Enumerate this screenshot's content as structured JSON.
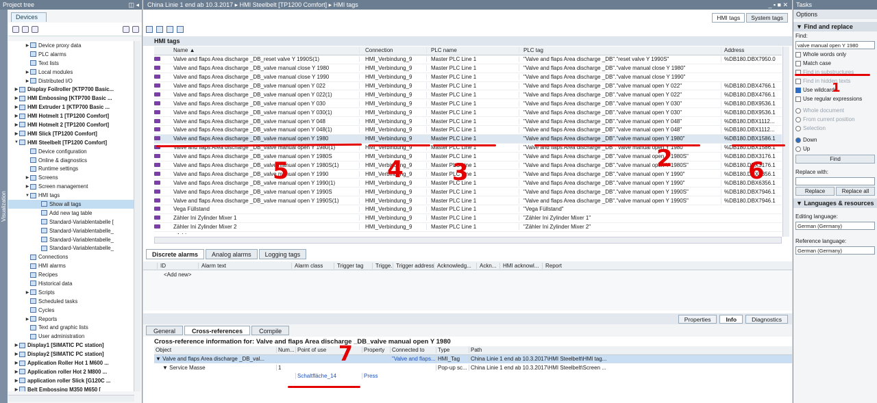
{
  "project_tree": {
    "title": "Project tree",
    "devices_tab": "Devices",
    "side_label": "Visualization",
    "items": [
      {
        "label": "Device proxy data",
        "bold": false,
        "arrow": "▶",
        "indent": 3
      },
      {
        "label": "PLC alarms",
        "bold": false,
        "arrow": "",
        "indent": 3
      },
      {
        "label": "Text lists",
        "bold": false,
        "arrow": "",
        "indent": 3
      },
      {
        "label": "Local modules",
        "bold": false,
        "arrow": "▶",
        "indent": 3
      },
      {
        "label": "Distributed I/O",
        "bold": false,
        "arrow": "▶",
        "indent": 3
      },
      {
        "label": "Display Foilroller [KTP700 Basic...",
        "bold": true,
        "arrow": "▶",
        "indent": 1
      },
      {
        "label": "HMI Embossing [KTP700 Basic ...",
        "bold": true,
        "arrow": "▶",
        "indent": 1
      },
      {
        "label": "HMI Extruder 1 [KTP700 Basic ...",
        "bold": true,
        "arrow": "▶",
        "indent": 1
      },
      {
        "label": "HMI Hotmelt 1 [TP1200 Comfort]",
        "bold": true,
        "arrow": "▶",
        "indent": 1
      },
      {
        "label": "HMI Hotmelt 2 [TP1200 Comfort]",
        "bold": true,
        "arrow": "▶",
        "indent": 1
      },
      {
        "label": "HMI Slick [TP1200 Comfort]",
        "bold": true,
        "arrow": "▶",
        "indent": 1
      },
      {
        "label": "HMI Steelbelt [TP1200 Comfort]",
        "bold": true,
        "arrow": "▼",
        "indent": 1
      },
      {
        "label": "Device configuration",
        "bold": false,
        "arrow": "",
        "indent": 3
      },
      {
        "label": "Online & diagnostics",
        "bold": false,
        "arrow": "",
        "indent": 3
      },
      {
        "label": "Runtime settings",
        "bold": false,
        "arrow": "",
        "indent": 3
      },
      {
        "label": "Screens",
        "bold": false,
        "arrow": "▶",
        "indent": 3
      },
      {
        "label": "Screen management",
        "bold": false,
        "arrow": "▶",
        "indent": 3
      },
      {
        "label": "HMI tags",
        "bold": false,
        "arrow": "▼",
        "indent": 3
      },
      {
        "label": "Show all tags",
        "bold": false,
        "arrow": "",
        "indent": 5,
        "selected": true
      },
      {
        "label": "Add new tag table",
        "bold": false,
        "arrow": "",
        "indent": 5
      },
      {
        "label": "Standard-Variablentabelle [",
        "bold": false,
        "arrow": "",
        "indent": 5
      },
      {
        "label": "Standard-Variablentabelle_",
        "bold": false,
        "arrow": "",
        "indent": 5
      },
      {
        "label": "Standard-Variablentabelle_",
        "bold": false,
        "arrow": "",
        "indent": 5
      },
      {
        "label": "Standard-Variablentabelle_",
        "bold": false,
        "arrow": "",
        "indent": 5
      },
      {
        "label": "Connections",
        "bold": false,
        "arrow": "",
        "indent": 3
      },
      {
        "label": "HMI alarms",
        "bold": false,
        "arrow": "",
        "indent": 3
      },
      {
        "label": "Recipes",
        "bold": false,
        "arrow": "",
        "indent": 3
      },
      {
        "label": "Historical data",
        "bold": false,
        "arrow": "",
        "indent": 3
      },
      {
        "label": "Scripts",
        "bold": false,
        "arrow": "▶",
        "indent": 3
      },
      {
        "label": "Scheduled tasks",
        "bold": false,
        "arrow": "",
        "indent": 3
      },
      {
        "label": "Cycles",
        "bold": false,
        "arrow": "",
        "indent": 3
      },
      {
        "label": "Reports",
        "bold": false,
        "arrow": "▶",
        "indent": 3
      },
      {
        "label": "Text and graphic lists",
        "bold": false,
        "arrow": "",
        "indent": 3
      },
      {
        "label": "User administration",
        "bold": false,
        "arrow": "",
        "indent": 3
      },
      {
        "label": "Display1 [SIMATIC PC station]",
        "bold": true,
        "arrow": "▶",
        "indent": 1
      },
      {
        "label": "Display2 [SIMATIC PC station]",
        "bold": true,
        "arrow": "▶",
        "indent": 1
      },
      {
        "label": "Application Roller Hot 1 M600 ...",
        "bold": true,
        "arrow": "▶",
        "indent": 1
      },
      {
        "label": "Application roller Hot 2 M800 ...",
        "bold": true,
        "arrow": "▶",
        "indent": 1
      },
      {
        "label": "application roller Slick [G120C ...",
        "bold": true,
        "arrow": "▶",
        "indent": 1
      },
      {
        "label": "Belt Embossing M350 M650 [",
        "bold": true,
        "arrow": "▶",
        "indent": 1
      }
    ]
  },
  "main": {
    "breadcrumb": "China Linie 1 end ab 10.3.2017 ▸ HMI Steelbelt [TP1200 Comfort] ▸ HMI tags",
    "window_buttons": "_ ▪ ■ ✕",
    "tabs": [
      "HMI tags",
      "System tags"
    ],
    "table_title": "HMI tags",
    "columns": [
      "Name ▲",
      "Connection",
      "PLC name",
      "PLC tag",
      "Address"
    ],
    "rows": [
      [
        "Valve and flaps Area discharge _DB_reset valve Y 1990S(1)",
        "HMI_Verbindung_9",
        "Master PLC Line 1",
        "\"Valve and flaps Area discharge _DB\".\"reset valve Y 1990S\"",
        "%DB180.DBX7950.0"
      ],
      [
        "Valve and flaps Area discharge _DB_valve manual close Y 1980",
        "HMI_Verbindung_9",
        "Master PLC Line 1",
        "\"Valve and flaps Area discharge _DB\".\"valve manual close Y 1980\"",
        ""
      ],
      [
        "Valve and flaps Area discharge _DB_valve manual close Y 1990",
        "HMI_Verbindung_9",
        "Master PLC Line 1",
        "\"Valve and flaps Area discharge _DB\".\"valve manual close Y 1990\"",
        ""
      ],
      [
        "Valve and flaps Area discharge _DB_valve manual open Y 022",
        "HMI_Verbindung_9",
        "Master PLC Line 1",
        "\"Valve and flaps Area discharge _DB\".\"valve manual open Y 022\"",
        "%DB180.DBX4766.1"
      ],
      [
        "Valve and flaps Area discharge _DB_valve manual open Y 022(1)",
        "HMI_Verbindung_9",
        "Master PLC Line 1",
        "\"Valve and flaps Area discharge _DB\".\"valve manual open Y 022\"",
        "%DB180.DBX4766.1"
      ],
      [
        "Valve and flaps Area discharge _DB_valve manual open Y 030",
        "HMI_Verbindung_9",
        "Master PLC Line 1",
        "\"Valve and flaps Area discharge _DB\".\"valve manual open Y 030\"",
        "%DB180.DBX9536.1"
      ],
      [
        "Valve and flaps Area discharge _DB_valve manual open Y 030(1)",
        "HMI_Verbindung_9",
        "Master PLC Line 1",
        "\"Valve and flaps Area discharge _DB\".\"valve manual open Y 030\"",
        "%DB180.DBX9536.1"
      ],
      [
        "Valve and flaps Area discharge _DB_valve manual open Y 048",
        "HMI_Verbindung_9",
        "Master PLC Line 1",
        "\"Valve and flaps Area discharge _DB\".\"valve manual open Y 048\"",
        "%DB180.DBX1112..."
      ],
      [
        "Valve and flaps Area discharge _DB_valve manual open Y 048(1)",
        "HMI_Verbindung_9",
        "Master PLC Line 1",
        "\"Valve and flaps Area discharge _DB\".\"valve manual open Y 048\"",
        "%DB180.DBX1112..."
      ],
      [
        "Valve and flaps Area discharge _DB_valve manual open Y 1980",
        "HMI_Verbindung_9",
        "Master PLC Line 1",
        "\"Valve and flaps Area discharge _DB\".\"valve manual open Y 1980\"",
        "%DB180.DBX1586.1"
      ],
      [
        "Valve and flaps Area discharge _DB_valve manual open Y 1980(1)",
        "HMI_Verbindung_9",
        "Master PLC Line 1",
        "\"Valve and flaps Area discharge _DB\".\"valve manual open Y 1980\"",
        "%DB180.DBX1586.1"
      ],
      [
        "Valve and flaps Area discharge _DB_valve manual open Y 1980S",
        "HMI_Verbindung_9",
        "Master PLC Line 1",
        "\"Valve and flaps Area discharge _DB\".\"valve manual open Y 1980S\"",
        "%DB180.DBX3176.1"
      ],
      [
        "Valve and flaps Area discharge _DB_valve manual open Y 1980S(1)",
        "HMI_Verbindung_9",
        "Master PLC Line 1",
        "\"Valve and flaps Area discharge _DB\".\"valve manual open Y 1980S\"",
        "%DB180.DBX3176.1"
      ],
      [
        "Valve and flaps Area discharge _DB_valve manual open Y 1990",
        "HMI_Verbindung_9",
        "Master PLC Line 1",
        "\"Valve and flaps Area discharge _DB\".\"valve manual open Y 1990\"",
        "%DB180.DBX6356.1"
      ],
      [
        "Valve and flaps Area discharge _DB_valve manual open Y 1990(1)",
        "HMI_Verbindung_9",
        "Master PLC Line 1",
        "\"Valve and flaps Area discharge _DB\".\"valve manual open Y 1990\"",
        "%DB180.DBX6356.1"
      ],
      [
        "Valve and flaps Area discharge _DB_valve manual open Y 1990S",
        "HMI_Verbindung_9",
        "Master PLC Line 1",
        "\"Valve and flaps Area discharge _DB\".\"valve manual open Y 1990S\"",
        "%DB180.DBX7946.1"
      ],
      [
        "Valve and flaps Area discharge _DB_valve manual open Y 1990S(1)",
        "HMI_Verbindung_9",
        "Master PLC Line 1",
        "\"Valve and flaps Area discharge _DB\".\"valve manual open Y 1990S\"",
        "%DB180.DBX7946.1"
      ],
      [
        "Vega Füllstand",
        "HMI_Verbindung_9",
        "Master PLC Line 1",
        "\"Vega Füllstand\"",
        ""
      ],
      [
        "Zähler Ini Zylinder Mixer 1",
        "HMI_Verbindung_9",
        "Master PLC Line 1",
        "\"Zähler Ini Zylinder Mixer 1\"",
        ""
      ],
      [
        "Zähler Ini Zylinder Mixer 2",
        "HMI_Verbindung_9",
        "Master PLC Line 1",
        "\"Zähler Ini Zylinder Mixer 2\"",
        ""
      ],
      [
        "<Add new>",
        "",
        "",
        "",
        ""
      ]
    ],
    "selected_row": 9
  },
  "alarms": {
    "tabs": [
      "Discrete alarms",
      "Analog alarms",
      "Logging tags"
    ],
    "columns": [
      "ID",
      "Alarm text",
      "Alarm class",
      "Trigger tag",
      "Trigge...",
      "Trigger address",
      "Acknowledg...",
      "Ackn...",
      "HMI acknowl...",
      "Report"
    ],
    "add_new": "<Add new>"
  },
  "inspector": {
    "top_tabs": [
      "Properties",
      "Info",
      "Diagnostics"
    ],
    "sub_tabs": [
      "General",
      "Cross-references",
      "Compile"
    ],
    "title": "Cross-reference information for: Valve and flaps Area discharge _DB_valve manual open Y 1980",
    "columns": [
      "Object",
      "Num...",
      "Point of use",
      "Property",
      "Connected to",
      "Type",
      "Path"
    ],
    "rows": [
      [
        "▼ Valve and flaps Area discharge _DB_val...",
        "",
        "",
        "",
        "\"Valve and flaps...",
        "HMI_Tag",
        "China Linie 1 end ab 10.3.2017\\HMI Steelbelt\\HMI tag..."
      ],
      [
        "▼ Service Masse",
        "1",
        "",
        "",
        "",
        "Pop-up sc...",
        "China Linie 1 end ab 10.3.2017\\HMI Steelbelt\\Screen ..."
      ],
      [
        "",
        "",
        "Schaltfläche_14",
        "Press",
        "",
        "",
        ""
      ]
    ]
  },
  "tasks": {
    "title": "Tasks",
    "options": "Options",
    "find_replace": {
      "header": "Find and replace",
      "find_label": "Find:",
      "find_value": "valve manual open Y 1980",
      "whole_words": "Whole words only",
      "match_case": "Match case",
      "find_sub": "Find in substructures",
      "find_hidden": "Find in hidden texts",
      "wildcards": "Use wildcards",
      "regex": "Use regular expressions",
      "whole_doc": "Whole document",
      "from_current": "From current position",
      "selection": "Selection",
      "down": "Down",
      "up": "Up",
      "find_btn": "Find",
      "replace_with": "Replace with:",
      "replace_btn": "Replace",
      "replace_all_btn": "Replace all"
    },
    "languages": {
      "header": "Languages & resources",
      "editing_label": "Editing language:",
      "editing_value": "German (Germany)",
      "reference_label": "Reference language:",
      "reference_value": "German (Germany)"
    }
  },
  "annotations": {
    "marks": [
      "1",
      "2",
      "3",
      "4",
      "5",
      "6",
      "7"
    ],
    "color": "#e40000"
  }
}
